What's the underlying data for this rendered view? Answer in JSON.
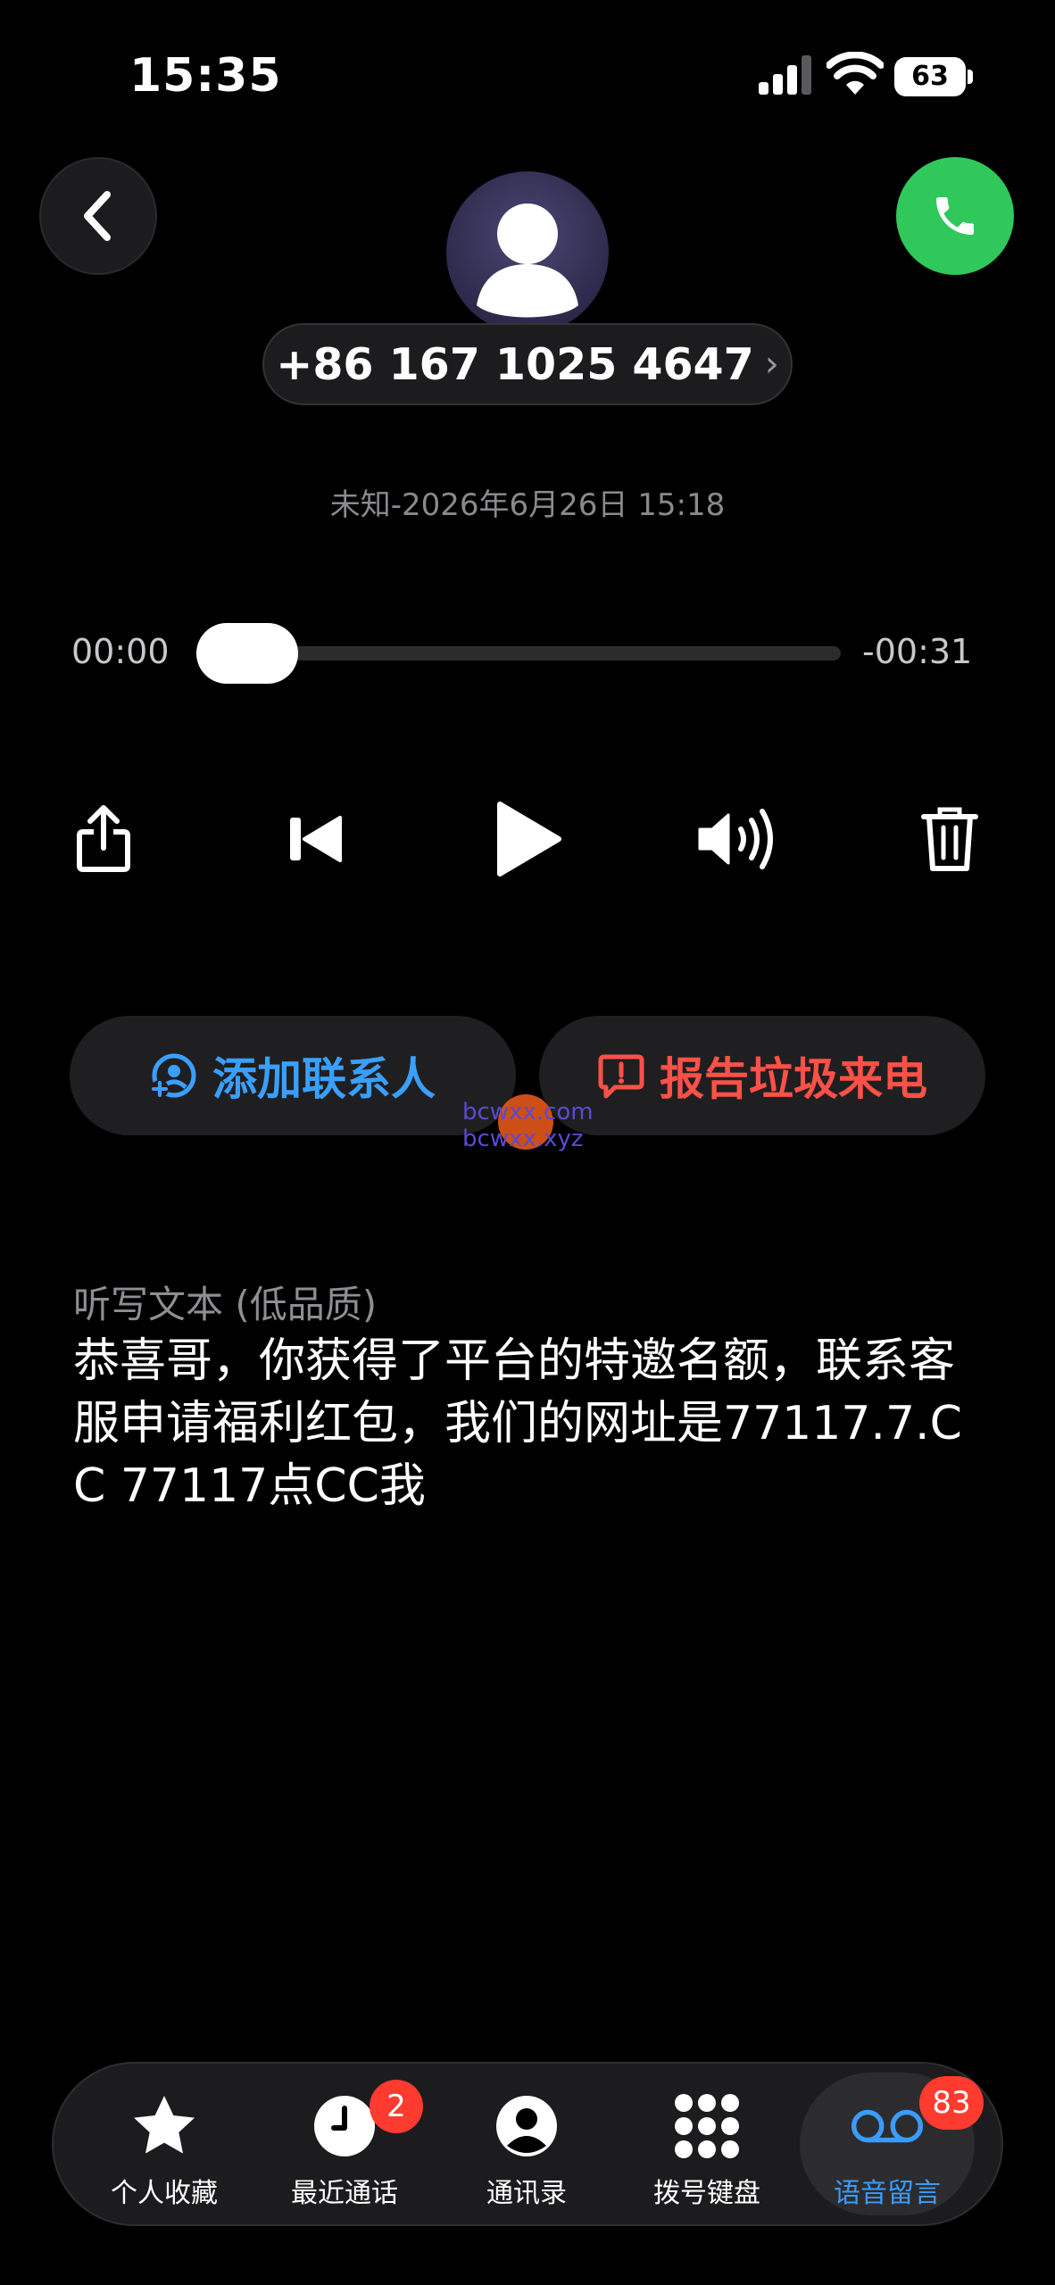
{
  "status_bar": {
    "time": "15:35",
    "battery": "63"
  },
  "header": {
    "phone_number": "+86 167 1025 4647",
    "number_chevron": "›",
    "meta": "未知-2026年6月26日 15:18"
  },
  "player": {
    "elapsed": "00:00",
    "remaining": "-00:31",
    "progress": 0
  },
  "actions": {
    "add_contact": "添加联系人",
    "report_spam": "报告垃圾来电"
  },
  "watermark": {
    "line1": "bcwxx.com",
    "line2": "bcwxx.xyz"
  },
  "transcript": {
    "label": "听写文本 (低品质)",
    "text": "恭喜哥，你获得了平台的特邀名额，联系客服申请福利红包，我们的网址是77117.7.CC 77117点CC我"
  },
  "tabs": [
    {
      "label": "个人收藏",
      "icon": "star-icon",
      "badge": ""
    },
    {
      "label": "最近通话",
      "icon": "clock-icon",
      "badge": "2"
    },
    {
      "label": "通讯录",
      "icon": "person-circle-icon",
      "badge": ""
    },
    {
      "label": "拨号键盘",
      "icon": "keypad-icon",
      "badge": ""
    },
    {
      "label": "语音留言",
      "icon": "voicemail-icon",
      "badge": "83",
      "active": true
    }
  ],
  "colors": {
    "accent_blue": "#3a9cff",
    "spam_red": "#ff5147",
    "call_green": "#30c85a",
    "badge_red": "#ff3b30"
  }
}
